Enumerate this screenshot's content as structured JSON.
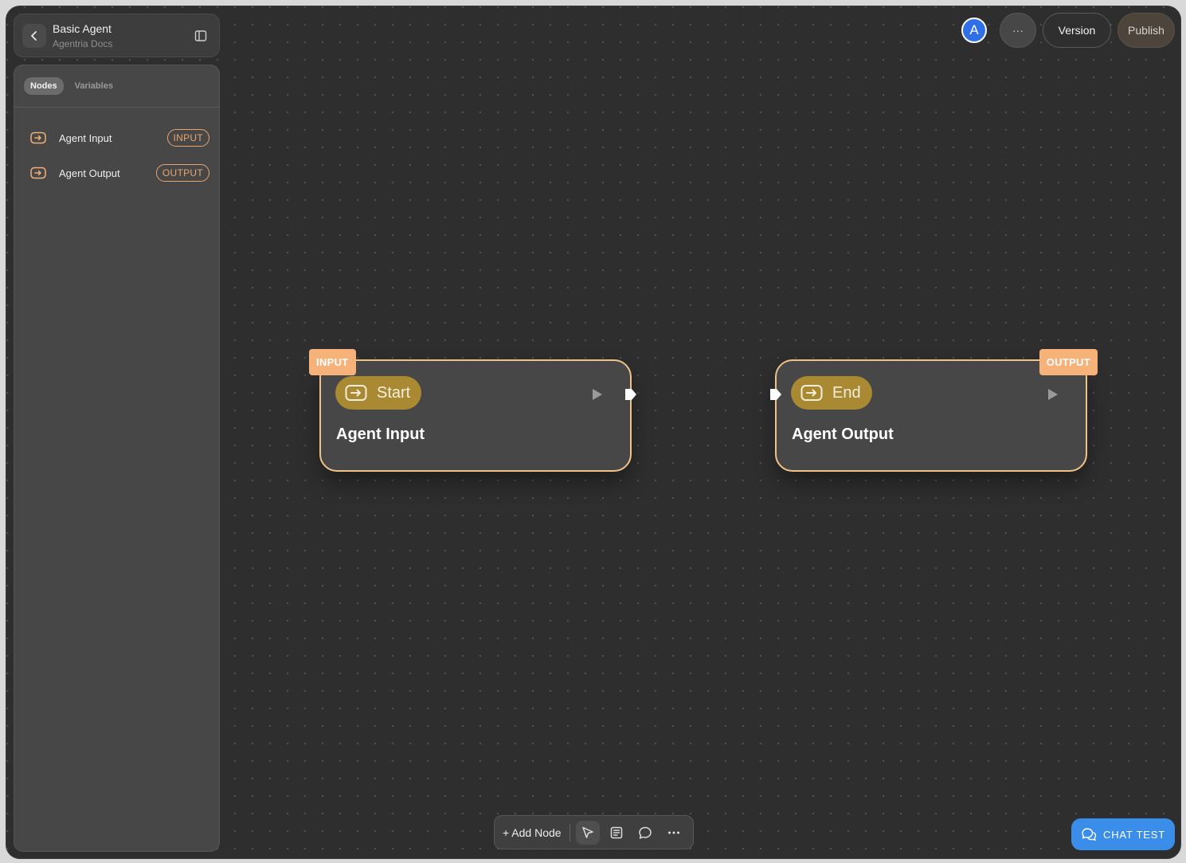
{
  "header": {
    "title": "Basic Agent",
    "subtitle": "Agentria Docs"
  },
  "sidebar": {
    "tabs": [
      {
        "label": "Nodes",
        "active": true
      },
      {
        "label": "Variables",
        "active": false
      }
    ],
    "items": [
      {
        "label": "Agent Input",
        "badge": "INPUT"
      },
      {
        "label": "Agent Output",
        "badge": "OUTPUT"
      }
    ]
  },
  "topbar": {
    "avatar_initial": "A",
    "more_label": "···",
    "version_label": "Version",
    "publish_label": "Publish"
  },
  "canvas": {
    "nodes": [
      {
        "tag": "INPUT",
        "pill": "Start",
        "name": "Agent Input"
      },
      {
        "tag": "OUTPUT",
        "pill": "End",
        "name": "Agent Output"
      }
    ]
  },
  "toolbar": {
    "add_node_label": "+ Add Node"
  },
  "chat": {
    "label": "CHAT TEST"
  },
  "colors": {
    "accent_orange": "#f7b27a",
    "node_border": "#f0c285",
    "pill_gold": "#a98932",
    "chat_blue": "#3a8de9",
    "avatar_blue": "#2f6fe8"
  }
}
